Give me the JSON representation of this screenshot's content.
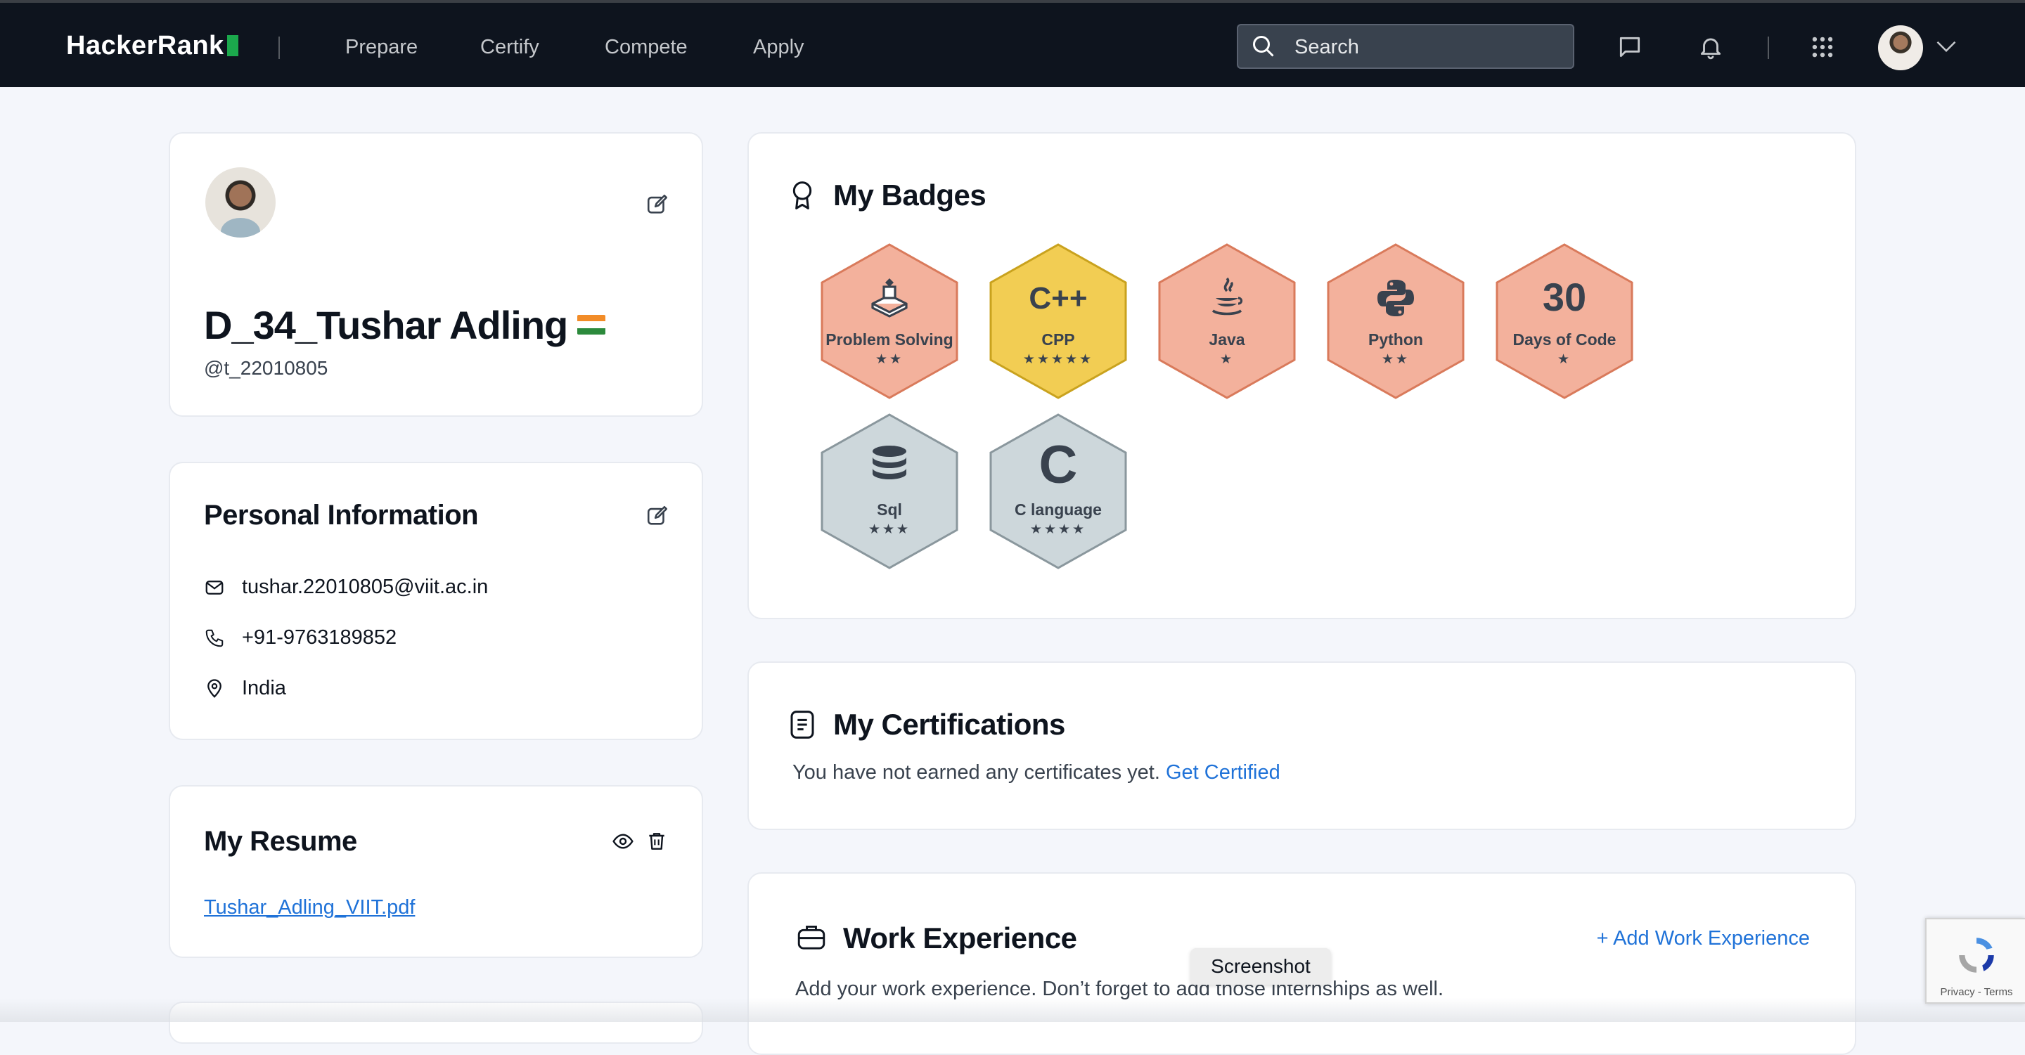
{
  "header": {
    "logo": "HackerRank",
    "nav": [
      "Prepare",
      "Certify",
      "Compete",
      "Apply"
    ],
    "search_placeholder": "Search"
  },
  "profile": {
    "name": "D_34_Tushar Adling",
    "username": "@t_22010805",
    "country_flag": "India"
  },
  "personal_info": {
    "title": "Personal Information",
    "email": "tushar.22010805@viit.ac.in",
    "phone": "+91-9763189852",
    "location": "India"
  },
  "resume": {
    "title": "My Resume",
    "file": "Tushar_Adling_VIIT.pdf"
  },
  "badges": {
    "title": "My Badges",
    "items": [
      {
        "name": "Problem Solving",
        "stars": "★★",
        "level": "bronze",
        "icon": "problem-solving-icon"
      },
      {
        "name": "CPP",
        "stars": "★★★★★",
        "level": "gold",
        "icon": "cpp-icon",
        "glyph": "C++"
      },
      {
        "name": "Java",
        "stars": "★",
        "level": "bronze",
        "icon": "java-icon"
      },
      {
        "name": "Python",
        "stars": "★★",
        "level": "bronze",
        "icon": "python-icon"
      },
      {
        "name": "Days of Code",
        "stars": "★",
        "level": "bronze",
        "icon": "thirty-icon",
        "glyph": "30"
      },
      {
        "name": "Sql",
        "stars": "★★★",
        "level": "silver",
        "icon": "database-icon"
      },
      {
        "name": "C language",
        "stars": "★★★★",
        "level": "silver",
        "icon": "c-language-icon",
        "glyph": "C"
      }
    ]
  },
  "certifications": {
    "title": "My Certifications",
    "message": "You have not earned any certificates yet.",
    "cta": "Get Certified"
  },
  "work_experience": {
    "title": "Work Experience",
    "add_label": "+ Add Work Experience",
    "message": "Add your work experience. Don’t forget to add those internships as well."
  },
  "tooltip": "Screenshot",
  "recaptcha": "Privacy - Terms",
  "colors": {
    "topbar": "#0e141e",
    "brand_green": "#1ba94c",
    "link": "#1f72d8",
    "bronze": "#f3b19c",
    "gold": "#f2cd53",
    "silver": "#cdd7db"
  }
}
